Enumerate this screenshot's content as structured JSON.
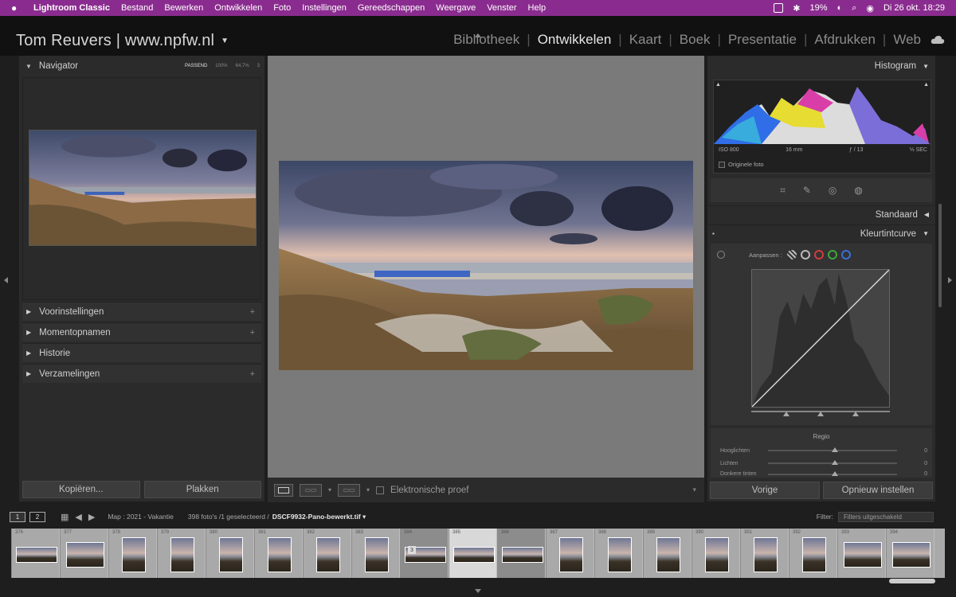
{
  "menubar": {
    "app": "Lightroom Classic",
    "items": [
      "Bestand",
      "Bewerken",
      "Ontwikkelen",
      "Foto",
      "Instellingen",
      "Gereedschappen",
      "Weergave",
      "Venster",
      "Help"
    ],
    "battery": "19%",
    "datetime": "Di 26 okt.  18:29"
  },
  "identity": "Tom Reuvers | www.npfw.nl",
  "modules": [
    "Bibliotheek",
    "Ontwikkelen",
    "Kaart",
    "Boek",
    "Presentatie",
    "Afdrukken",
    "Web"
  ],
  "active_module": "Ontwikkelen",
  "left": {
    "navigator": {
      "title": "Navigator",
      "zoom": [
        "PASSEND",
        "100%",
        "64,7%",
        "3"
      ]
    },
    "sections": [
      "Voorinstellingen",
      "Momentopnamen",
      "Historie",
      "Verzamelingen"
    ],
    "copy_label": "Kopiëren...",
    "paste_label": "Plakken"
  },
  "toolbar": {
    "proof_label": "Elektronische proef"
  },
  "right": {
    "histogram": {
      "title": "Histogram",
      "iso": "ISO 800",
      "focal": "16 mm",
      "aperture": "ƒ / 13",
      "shutter": "⅓ SEC",
      "original": "Originele foto"
    },
    "standaard": "Standaard",
    "curve": {
      "title": "Kleurtintcurve",
      "adjust": "Aanpassen :",
      "dot_colors": [
        "#bbbbbb",
        "#d23b3b",
        "#3ca83c",
        "#3a6fd8"
      ]
    },
    "regio": {
      "title": "Regio",
      "rows": [
        {
          "label": "Hooglichten",
          "value": "0"
        },
        {
          "label": "Lichten",
          "value": "0"
        },
        {
          "label": "Donkere tinten",
          "value": "0"
        }
      ]
    },
    "prev_label": "Vorige",
    "reset_label": "Opnieuw instellen"
  },
  "filmbar": {
    "mon1": "1",
    "mon2": "2",
    "path": "Map : 2021 - Vakantie",
    "count": "398 foto's /1 geselecteerd /",
    "file": "DSCF9932-Pano-bewerkt.tif ▾",
    "filter_label": "Filter:",
    "filter_value": "Filters uitgeschakeld"
  },
  "filmstrip": [
    {
      "num": "376",
      "kind": "pano"
    },
    {
      "num": "377",
      "kind": "wide"
    },
    {
      "num": "378",
      "kind": "tall"
    },
    {
      "num": "379",
      "kind": "tall"
    },
    {
      "num": "380",
      "kind": "tall"
    },
    {
      "num": "381",
      "kind": "tall"
    },
    {
      "num": "382",
      "kind": "tall"
    },
    {
      "num": "383",
      "kind": "tall"
    },
    {
      "num": "384",
      "kind": "pano",
      "state": "sel",
      "badge": "3"
    },
    {
      "num": "385",
      "kind": "pano",
      "state": "active"
    },
    {
      "num": "386",
      "kind": "pano",
      "state": "sel"
    },
    {
      "num": "387",
      "kind": "tall"
    },
    {
      "num": "388",
      "kind": "tall"
    },
    {
      "num": "389",
      "kind": "tall"
    },
    {
      "num": "390",
      "kind": "tall"
    },
    {
      "num": "391",
      "kind": "tall"
    },
    {
      "num": "392",
      "kind": "tall"
    },
    {
      "num": "393",
      "kind": "wide"
    },
    {
      "num": "394",
      "kind": "wide"
    }
  ]
}
